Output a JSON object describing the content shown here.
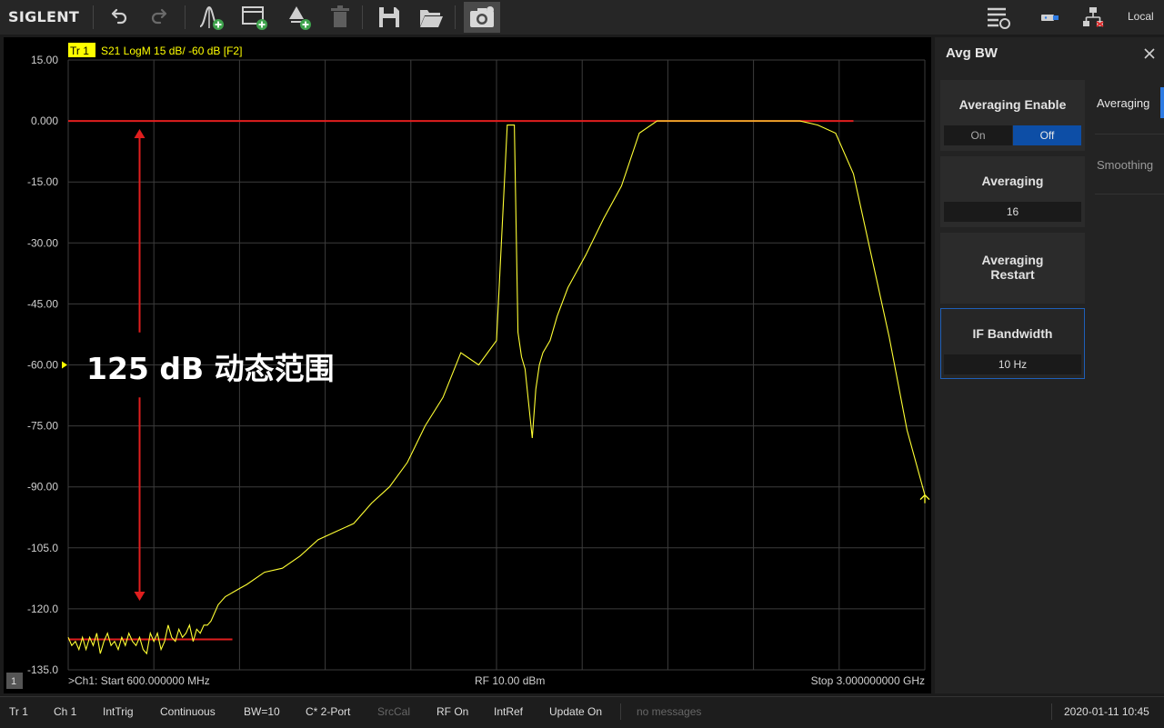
{
  "toolbar": {
    "brand": "SIGLENT",
    "icons": [
      "undo-icon",
      "redo-icon",
      "add-marker-icon",
      "add-window-icon",
      "add-trace-icon",
      "delete-icon",
      "save-icon",
      "open-folder-icon",
      "screenshot-icon"
    ],
    "right_icons": [
      "settings-menu-icon",
      "usb-icon",
      "network-icon"
    ],
    "local_label": "Local"
  },
  "trace": {
    "tag": "Tr 1",
    "info": "S21 LogM 15 dB/ -60 dB [F2]"
  },
  "annotation": "125 dB 动态范围",
  "chart_data": {
    "type": "line",
    "title": "",
    "ylabel": "",
    "xlabel": "",
    "y_unit": "dB",
    "ylim": [
      -135,
      15
    ],
    "yticks": [
      "15.00",
      "0.000",
      "-15.00",
      "-30.00",
      "-45.00",
      "-60.00",
      "-75.00",
      "-90.00",
      "-105.0",
      "-120.0",
      "-135.0"
    ],
    "x_start_label": ">Ch1: Start 600.000000 MHz",
    "x_center_label": "RF 10.00 dBm",
    "x_stop_label": "Stop 3.000000000 GHz",
    "x_start_ghz": 0.6,
    "x_stop_ghz": 3.0,
    "grid": true,
    "reference_level_marker": -60,
    "series": [
      {
        "color": "#ffff33",
        "x_ghz": [
          0.6,
          0.61,
          0.62,
          0.63,
          0.64,
          0.65,
          0.66,
          0.67,
          0.68,
          0.69,
          0.7,
          0.71,
          0.72,
          0.73,
          0.74,
          0.75,
          0.76,
          0.77,
          0.78,
          0.79,
          0.8,
          0.81,
          0.82,
          0.83,
          0.84,
          0.85,
          0.86,
          0.87,
          0.88,
          0.89,
          0.9,
          0.91,
          0.92,
          0.93,
          0.94,
          0.95,
          0.96,
          0.97,
          0.98,
          0.99,
          1.0,
          1.02,
          1.04,
          1.06,
          1.08,
          1.1,
          1.15,
          1.2,
          1.25,
          1.3,
          1.35,
          1.4,
          1.45,
          1.5,
          1.55,
          1.6,
          1.65,
          1.7,
          1.75,
          1.8,
          1.83,
          1.85,
          1.86,
          1.87,
          1.88,
          1.9,
          1.91,
          1.92,
          1.93,
          1.95,
          1.97,
          2.0,
          2.05,
          2.1,
          2.15,
          2.2,
          2.25,
          2.3,
          2.35,
          2.4,
          2.45,
          2.5,
          2.55,
          2.6,
          2.65,
          2.7,
          2.75,
          2.8,
          2.85,
          2.9,
          2.95,
          3.0
        ],
        "y_db": [
          -127,
          -129,
          -128,
          -130,
          -127,
          -130,
          -127,
          -129,
          -126,
          -131,
          -128,
          -126,
          -129,
          -128,
          -130,
          -127,
          -129,
          -126,
          -128,
          -129,
          -127,
          -130,
          -131,
          -126,
          -128,
          -126,
          -130,
          -128,
          -124,
          -127,
          -128,
          -125,
          -127,
          -126,
          -124,
          -128,
          -125,
          -126,
          -124,
          -124,
          -123,
          -119,
          -117,
          -116,
          -115,
          -114,
          -111,
          -110,
          -107,
          -103,
          -101,
          -99,
          -94,
          -90,
          -84,
          -75,
          -68,
          -57,
          -60,
          -54,
          -1,
          -1,
          -52,
          -58,
          -61,
          -78,
          -66,
          -60,
          -57,
          -54,
          -48,
          -41,
          -33,
          -24,
          -16,
          -3,
          0,
          0,
          0,
          0,
          0,
          0,
          0,
          0,
          0,
          -1,
          -3,
          -13,
          -33,
          -53,
          -76,
          -92
        ]
      }
    ],
    "reference_lines": [
      {
        "label": "top",
        "y_db": 0,
        "color": "#e01e1e"
      },
      {
        "label": "bottom",
        "y_db": -127.5,
        "color": "#e01e1e"
      }
    ],
    "range_arrow": {
      "from_db": -2,
      "to_db": -118,
      "label": "125 dB 动态范围"
    }
  },
  "panel": {
    "title": "Avg BW",
    "close_icon": "close-icon",
    "cards": {
      "averaging_enable": {
        "label": "Averaging Enable",
        "on": "On",
        "off": "Off",
        "selected": "Off"
      },
      "averaging": {
        "label": "Averaging",
        "value": "16"
      },
      "averaging_restart": {
        "label": "Averaging Restart"
      },
      "if_bandwidth": {
        "label": "IF Bandwidth",
        "value": "10 Hz"
      }
    },
    "tabs": {
      "averaging": "Averaging",
      "smoothing": "Smoothing"
    },
    "accent_color": "#0d4ea6"
  },
  "channel_badge": "1",
  "statusbar": {
    "tr": "Tr 1",
    "ch": "Ch 1",
    "trig": "IntTrig",
    "mode": "Continuous",
    "bw": "BW=10",
    "cal": "C* 2-Port",
    "srccal": "SrcCal",
    "rf": "RF On",
    "ref": "IntRef",
    "update": "Update On",
    "messages": "no messages",
    "datetime": "2020-01-11 10:45"
  }
}
